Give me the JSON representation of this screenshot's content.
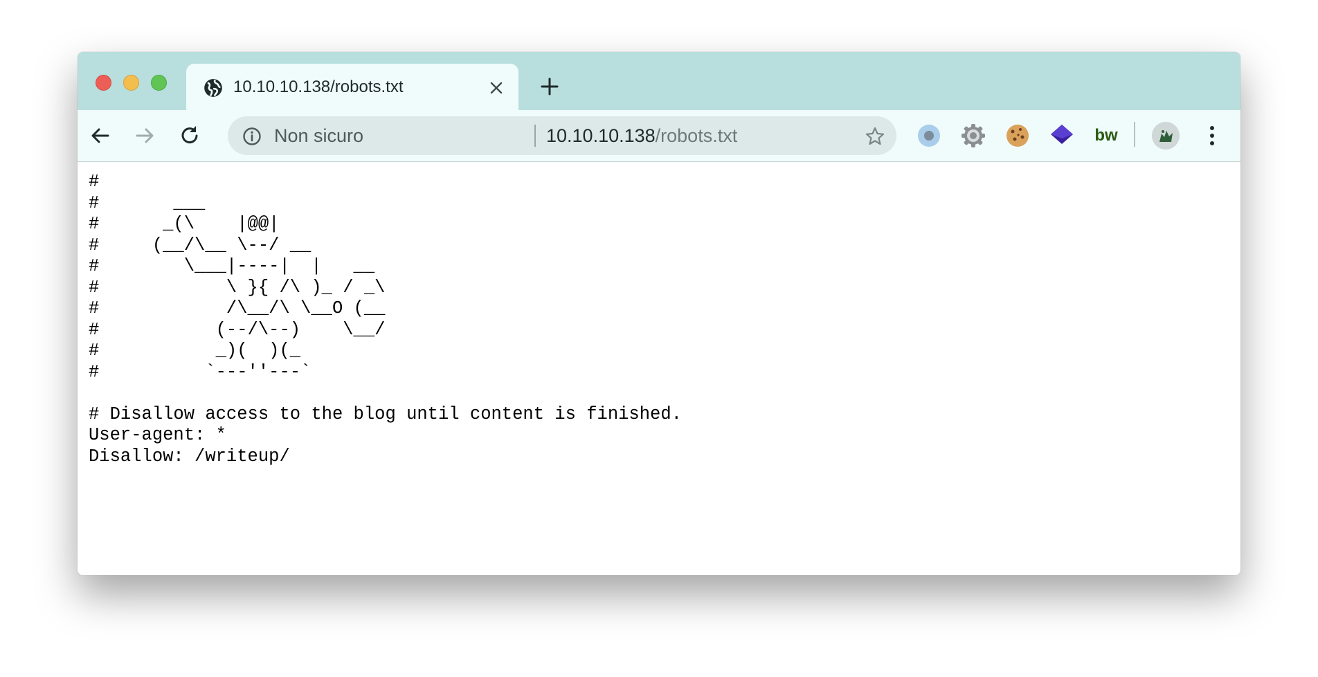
{
  "window": {
    "active_tab": {
      "title": "10.10.10.138/robots.txt"
    }
  },
  "omnibox": {
    "security_label": "Non sicuro",
    "url_host": "10.10.10.138",
    "url_path": "/robots.txt"
  },
  "toolbar": {
    "icons": [
      "back-icon",
      "forward-icon",
      "reload-icon",
      "info-icon",
      "star-icon",
      "extension-circle-icon",
      "extension-gear-icon",
      "extension-cookie-icon",
      "extension-layers-icon",
      "extension-bw-icon",
      "profile-avatar",
      "more-menu-icon"
    ],
    "extension_bw_label": "bw"
  },
  "colors": {
    "tabstrip": "#b8dedd",
    "toolbar": "#f0fbfb",
    "omnibox": "#dde8e8",
    "close": "#ed5f56",
    "minimize": "#f4be4f",
    "maximize": "#60c554"
  },
  "page": {
    "text": "#\n#       ___\n#      _(\\    |@@|\n#     (__/\\__ \\--/ __\n#        \\___|----|  |   __\n#            \\ }{ /\\ )_ / _\\\n#            /\\__/\\ \\__O (__\n#           (--/\\--)    \\__/\n#           _)(  )(_\n#          `---''---`\n\n# Disallow access to the blog until content is finished.\nUser-agent: *\nDisallow: /writeup/"
  }
}
